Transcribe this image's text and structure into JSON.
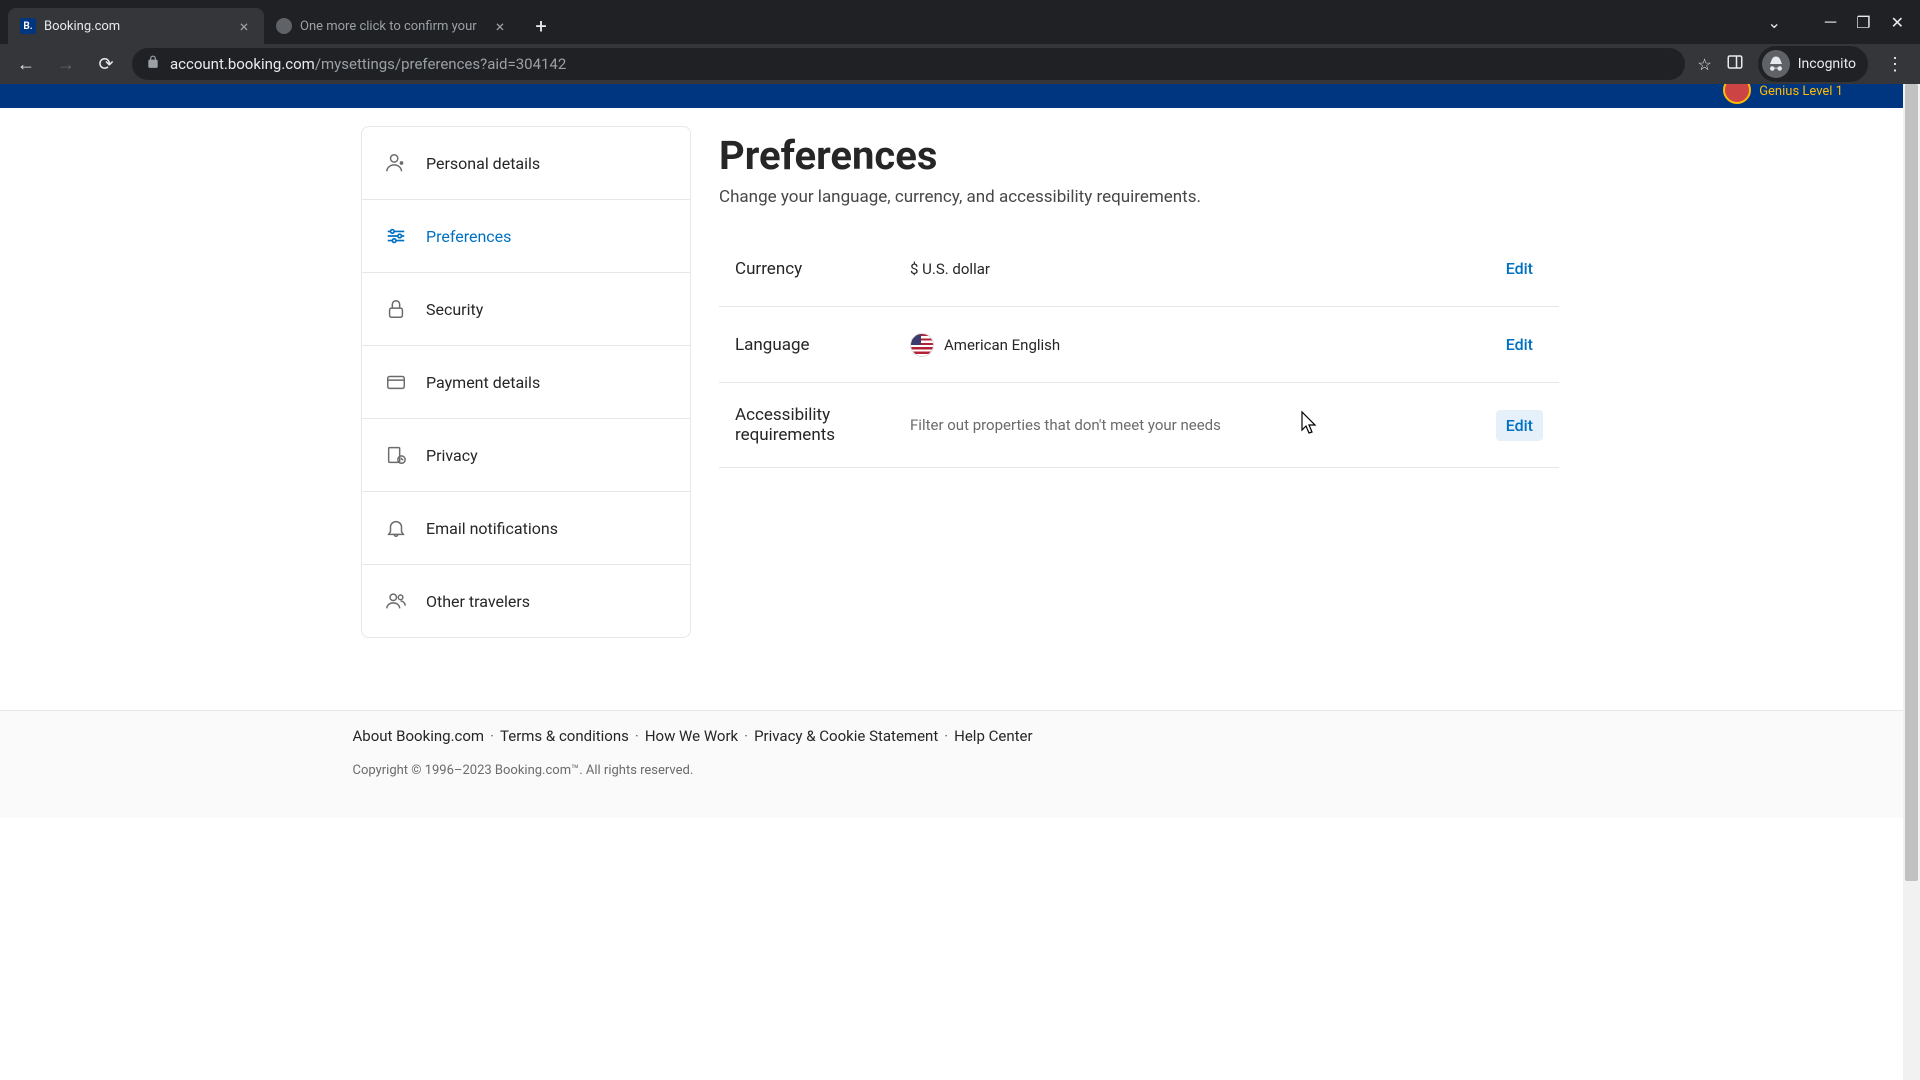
{
  "browser": {
    "tabs": [
      {
        "title": "Booking.com",
        "favicon": "B.",
        "active": true
      },
      {
        "title": "One more click to confirm your",
        "favicon": "",
        "active": false
      }
    ],
    "url_host": "account.booking.com",
    "url_path": "/mysettings/preferences?aid=304142",
    "incognito_label": "Incognito"
  },
  "header": {
    "genius_level": "Genius Level 1"
  },
  "sidebar": {
    "items": [
      {
        "label": "Personal details",
        "icon": "person"
      },
      {
        "label": "Preferences",
        "icon": "sliders",
        "active": true
      },
      {
        "label": "Security",
        "icon": "lock"
      },
      {
        "label": "Payment details",
        "icon": "card"
      },
      {
        "label": "Privacy",
        "icon": "privacy"
      },
      {
        "label": "Email notifications",
        "icon": "bell"
      },
      {
        "label": "Other travelers",
        "icon": "people"
      }
    ]
  },
  "page": {
    "title": "Preferences",
    "subtitle": "Change your language, currency, and accessibility requirements.",
    "settings": [
      {
        "label": "Currency",
        "value": "$ U.S. dollar",
        "edit": "Edit"
      },
      {
        "label": "Language",
        "value": "American English",
        "edit": "Edit",
        "flag": true
      },
      {
        "label": "Accessibility requirements",
        "value": "Filter out properties that don't meet your needs",
        "edit": "Edit",
        "muted": true,
        "hover": true
      }
    ]
  },
  "footer": {
    "links": [
      "About Booking.com",
      "Terms & conditions",
      "How We Work",
      "Privacy & Cookie Statement",
      "Help Center"
    ],
    "copyright": "Copyright © 1996–2023 Booking.com™. All rights reserved."
  }
}
